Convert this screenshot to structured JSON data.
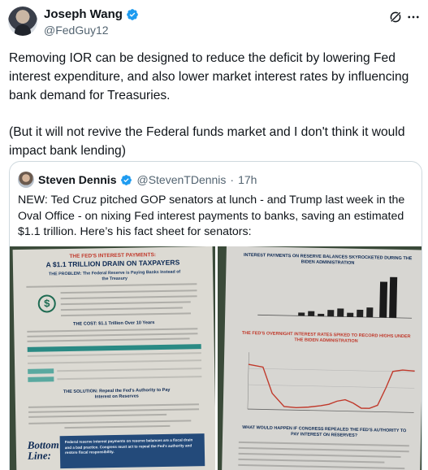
{
  "author": {
    "display_name": "Joseph Wang",
    "handle": "@FedGuy12"
  },
  "post": {
    "paragraphs": [
      "Removing IOR can be designed to reduce the deficit by lowering Fed interest expenditure, and also lower market interest rates by influencing bank demand for Treasuries.",
      "(But it will not revive the Federal funds market and I don't think it would impact bank lending)"
    ]
  },
  "quoted": {
    "display_name": "Steven Dennis",
    "handle": "@StevenTDennis",
    "separator": "·",
    "time": "17h",
    "text": "NEW: Ted Cruz pitched GOP senators at lunch - and Trump last week in the Oval Office - on nixing Fed interest payments to banks, saving an estimated $1.1 trillion. Here’s his fact sheet for senators:",
    "image_left": {
      "heading_small": "THE FED'S INTEREST PAYMENTS:",
      "heading_big": "A $1.1 TRILLION DRAIN ON TAXPAYERS",
      "problem": "THE PROBLEM: The Federal Reserve is Paying Banks Instead of the Treasury",
      "cost": "THE COST: $1.1 Trillion Over 10 Years",
      "solution": "THE SOLUTION: Repeal the Fed's Authority to Pay Interest on Reserves",
      "bottom_line_label": "Bottom Line:",
      "bottom_line_text": "Federal reserve interest payments on reserve balances are a fiscal drain and a bad practice. Congress must act to repeal the Fed's authority and restore fiscal responsibility."
    },
    "image_right": {
      "chart1_title": "INTEREST PAYMENTS ON RESERVE BALANCES SKYROCKETED DURING THE BIDEN ADMINISTRATION",
      "chart2_title": "THE FED'S OVERNIGHT INTEREST RATES SPIKED TO RECORD HIGHS UNDER THE BIDEN ADMINISTRATION",
      "question": "WHAT WOULD HAPPEN IF CONGRESS REPEALED THE FED'S AUTHORITY TO PAY INTEREST ON RESERVES?"
    }
  },
  "icons": {
    "verified": "verified-badge-icon",
    "grok": "grok-icon",
    "more": "more-icon"
  },
  "colors": {
    "verified": "#1d9bf0",
    "secondary_text": "#536471",
    "border": "#cfd9de",
    "navy": "#0e2a54",
    "teal": "#2a8a84"
  }
}
